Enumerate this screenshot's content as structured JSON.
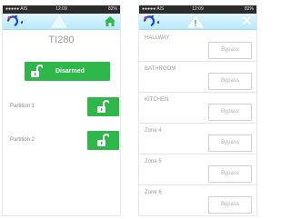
{
  "status_bar": {
    "carrier": "●●●●● AIS",
    "time": "12:09",
    "battery": "82%"
  },
  "left_screen": {
    "title": "TI280",
    "main_button": {
      "label": "Disarmed",
      "state": "unlocked"
    },
    "partitions": [
      {
        "label": "Partition 1",
        "state": "unlocked"
      },
      {
        "label": "Partition 2",
        "state": "unlocked"
      }
    ]
  },
  "right_screen": {
    "zones": [
      {
        "name": "HALLWAY",
        "action": "Bypass"
      },
      {
        "name": "BATHROOM",
        "action": "Bypass"
      },
      {
        "name": "KITCHEN",
        "action": "Bypass"
      },
      {
        "name": "Zone 4",
        "action": "Bypass"
      },
      {
        "name": "Zone 5",
        "action": "Bypass"
      },
      {
        "name": "Zone 6",
        "action": "Bypass"
      }
    ]
  },
  "icons": {
    "logo": "brand-logo-icon",
    "warning": "warning-icon",
    "home": "home-icon",
    "close": "close-icon",
    "lock": "unlocked-padlock-icon"
  },
  "colors": {
    "accent_green": "#2fb84a",
    "app_bar": "#b8e9fa",
    "status_bar": "#2b2b2b"
  }
}
